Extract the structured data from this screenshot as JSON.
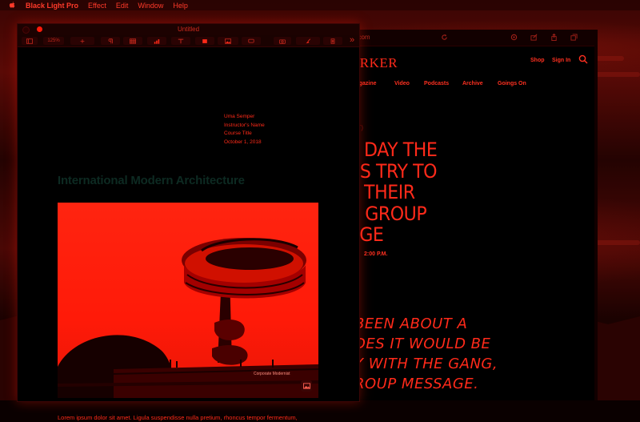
{
  "menubar": {
    "app_name": "Black Light Pro",
    "items": [
      "Effect",
      "Edit",
      "Window",
      "Help"
    ]
  },
  "pages_window": {
    "title": "Untitled",
    "toolbar": {
      "zoom": "125%"
    },
    "document": {
      "header_lines": [
        "Uma Semper",
        "Instructor's Name",
        "Course Title",
        "October 1, 2018"
      ],
      "heading": "International Modern Architecture",
      "image_caption": "Corporate Modernist",
      "body_text": "Lorem ipsum dolor sit amet. Ligula suspendisse nulla pretium, rhoncus tempor fermentum,"
    }
  },
  "browser_window": {
    "url_fragment": "t.com",
    "site_logo": "ORKER",
    "header_links": {
      "shop": "Shop",
      "sign_in": "Sign In"
    },
    "nav_items": [
      "Magazine",
      "Video",
      "Podcasts",
      "Archive",
      "Goings On"
    ],
    "article": {
      "kicker": "OUT)",
      "headline_lines": [
        "E DAY THE",
        "RS TRY TO",
        "E THEIR",
        "A GROUP",
        "AGE"
      ],
      "time": "2:00 P.M.",
      "cartoon_lines": [
        "BEEN ABOUT A",
        "DES IT WOULD BE",
        "Y WITH THE GANG,",
        "ROUP MESSAGE."
      ]
    }
  },
  "colors": {
    "accent": "#ff2a1a",
    "heading_text": "#0d2a22",
    "window_bg": "#000000",
    "photo_red": "#ff1a08"
  }
}
